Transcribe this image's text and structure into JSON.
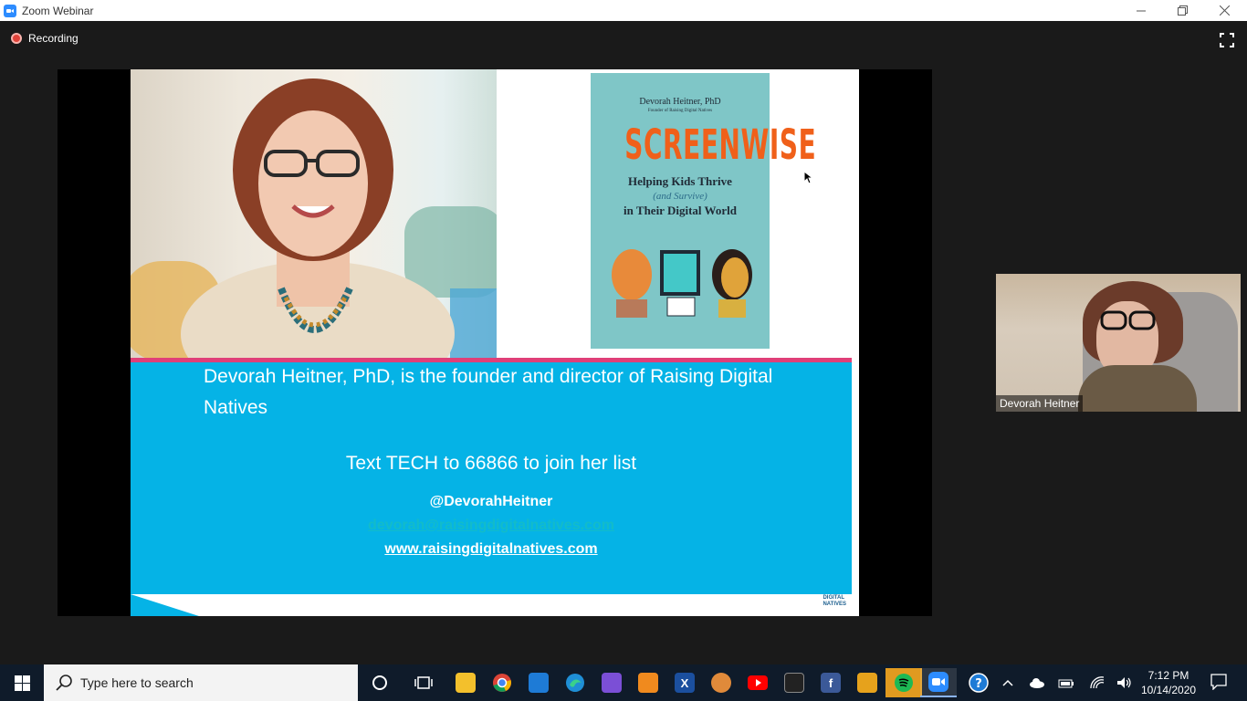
{
  "window": {
    "title": "Zoom Webinar"
  },
  "meeting": {
    "recording_label": "Recording"
  },
  "slide": {
    "book": {
      "author": "Devorah Heitner, PhD",
      "role": "Founder of Raising Digital Natives",
      "title": "SCREENWISE",
      "subtitle_line1": "Helping Kids Thrive",
      "subtitle_line2": "(and Survive)",
      "subtitle_line3": "in Their Digital World"
    },
    "bio": "Devorah Heitner, PhD, is the founder and director of Raising Digital Natives",
    "text_line": "Text TECH to 66866 to join her list",
    "handle": "@DevorahHeitner",
    "email": "devorah@raisingdigitalnatives.com",
    "website": "www.raisingdigitalnatives.com",
    "logo_line1": "DIGITAL",
    "logo_line2": "NATIVES"
  },
  "participant": {
    "name": "Devorah Heitner"
  },
  "taskbar": {
    "search_placeholder": "Type here to search",
    "time": "7:12 PM",
    "date": "10/14/2020"
  },
  "colors": {
    "zoom_blue": "#2d8cff",
    "slide_blue": "#05b3e6",
    "book_orange": "#f0601a",
    "accent_pink": "#e03f78"
  }
}
